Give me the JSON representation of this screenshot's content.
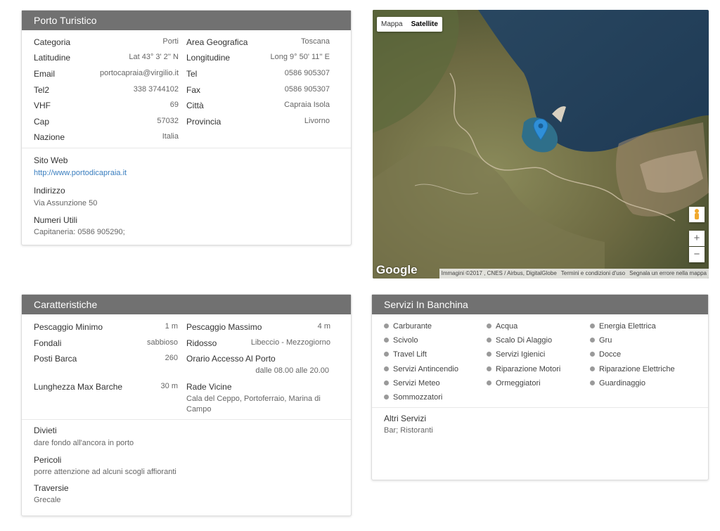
{
  "porto": {
    "title": "Porto Turistico",
    "left": [
      {
        "k": "Categoria",
        "v": "Porti"
      },
      {
        "k": "Latitudine",
        "v": "Lat 43° 3' 2'' N"
      },
      {
        "k": "Email",
        "v": "portocapraia@virgilio.it"
      },
      {
        "k": "Tel2",
        "v": "338 3744102"
      },
      {
        "k": "VHF",
        "v": "69"
      },
      {
        "k": "Cap",
        "v": "57032"
      },
      {
        "k": "Nazione",
        "v": "Italia"
      }
    ],
    "right": [
      {
        "k": "Area Geografica",
        "v": "Toscana"
      },
      {
        "k": "Longitudine",
        "v": "Long 9° 50' 11'' E"
      },
      {
        "k": "Tel",
        "v": "0586 905307"
      },
      {
        "k": "Fax",
        "v": "0586 905307"
      },
      {
        "k": "Città",
        "v": "Capraia Isola"
      },
      {
        "k": "Provincia",
        "v": "Livorno"
      }
    ],
    "sito_label": "Sito Web",
    "sito_value": "http://www.portodicapraia.it",
    "indirizzo_label": "Indirizzo",
    "indirizzo_value": "Via Assunzione 50",
    "numeri_label": "Numeri Utili",
    "numeri_value": "Capitaneria: 0586 905290;"
  },
  "map": {
    "type_map": "Mappa",
    "type_satellite": "Satellite",
    "zoom_in": "+",
    "zoom_out": "−",
    "logo": "Google",
    "attribution": "Immagini ©2017 , CNES / Airbus, DigitalGlobe",
    "terms": "Termini e condizioni d'uso",
    "report": "Segnala un errore nella mappa"
  },
  "caratteristiche": {
    "title": "Caratteristiche",
    "left": [
      {
        "k": "Pescaggio Minimo",
        "v": "1 m"
      },
      {
        "k": "Fondali",
        "v": "sabbioso"
      },
      {
        "k": "Posti Barca",
        "v": "260"
      },
      {
        "k": "Lunghezza Max Barche",
        "v": "30 m"
      }
    ],
    "right": [
      {
        "k": "Pescaggio Massimo",
        "v": "4 m"
      },
      {
        "k": "Ridosso",
        "v": "Libeccio - Mezzogiorno"
      },
      {
        "k": "Orario Accesso Al Porto",
        "v": "dalle 08.00 alle 20.00"
      },
      {
        "k": "Rade Vicine",
        "v": "Cala del Ceppo, Portoferraio, Marina di Campo"
      }
    ],
    "divieti_label": "Divieti",
    "divieti_value": "dare fondo all'ancora in porto",
    "pericoli_label": "Pericoli",
    "pericoli_value": "porre attenzione ad alcuni scogli affioranti",
    "traversie_label": "Traversie",
    "traversie_value": "Grecale"
  },
  "servizi": {
    "title": "Servizi In Banchina",
    "items": [
      "Carburante",
      "Acqua",
      "Energia Elettrica",
      "Scivolo",
      "Scalo Di Alaggio",
      "Gru",
      "Travel Lift",
      "Servizi Igienici",
      "Docce",
      "Servizi Antincendio",
      "Riparazione Motori",
      "Riparazione Elettriche",
      "Servizi Meteo",
      "Ormeggiatori",
      "Guardinaggio",
      "Sommozzatori"
    ],
    "altri_label": "Altri Servizi",
    "altri_value": "Bar; Ristoranti"
  }
}
